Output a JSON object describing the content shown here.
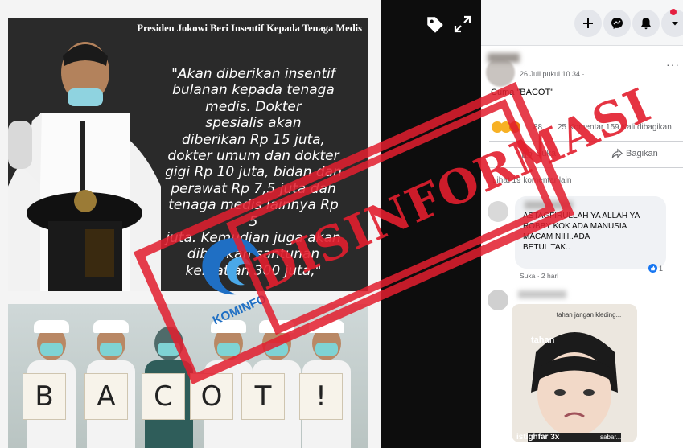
{
  "post_image": {
    "header": "Presiden Jokowi Beri Insentif Kepada Tenaga Medis",
    "quote_lines": [
      "\"Akan diberikan insentif",
      "bulanan kepada tenaga",
      "medis. Dokter",
      "spesialis akan",
      "diberikan Rp 15 juta,",
      "dokter umum dan dokter",
      "gigi Rp 10 juta, bidan dan",
      "perawat Rp 7,5 juta dan",
      "tenaga medis lainnya Rp 5",
      "juta. Kemudian juga akan",
      "diberikan santunan",
      "kematian 300 juta,\""
    ],
    "sign_letters": [
      "B",
      "A",
      "C",
      "O",
      "T",
      "!"
    ]
  },
  "stamp": {
    "text": "DISINFORMASI",
    "color": "#e21e2e"
  },
  "logo": {
    "name": "KOMINFO",
    "color": "#1f6fc4"
  },
  "viewer_toolbar": {
    "tag_icon": "tag-icon",
    "expand_icon": "expand-icon"
  },
  "header_bar": {
    "buttons": [
      {
        "icon": "plus-icon"
      },
      {
        "icon": "messenger-icon"
      },
      {
        "icon": "bell-icon"
      },
      {
        "icon": "chevron-down-icon"
      }
    ],
    "notification_color": "#e41e3f"
  },
  "post": {
    "time": "26 Juli pukul 10.34 ·",
    "caption": "Cuma \"BACOT\"",
    "reaction_count": "88",
    "comments": "25 Komentar",
    "shares": "159 Kali dibagikan",
    "like_label": "Suka",
    "share_label": "Bagikan",
    "more_comments": "Lihat 19 komentar lain"
  },
  "comment1": {
    "text_lines": [
      "ASTAGFIRULLAH YA ALLAH YA",
      "ROBBY KOK ADA MANUSIA",
      "MACAM NIH..ADA",
      "BETUL TAK.."
    ],
    "meta": "Suka · 2 hari",
    "reaction_count": "1"
  },
  "sticker": {
    "caption_top": "tahan jangan kleding...",
    "caption_left": "tahan",
    "caption_bottom_left": "istighfar 3x",
    "caption_bottom_right": "sabar..."
  }
}
